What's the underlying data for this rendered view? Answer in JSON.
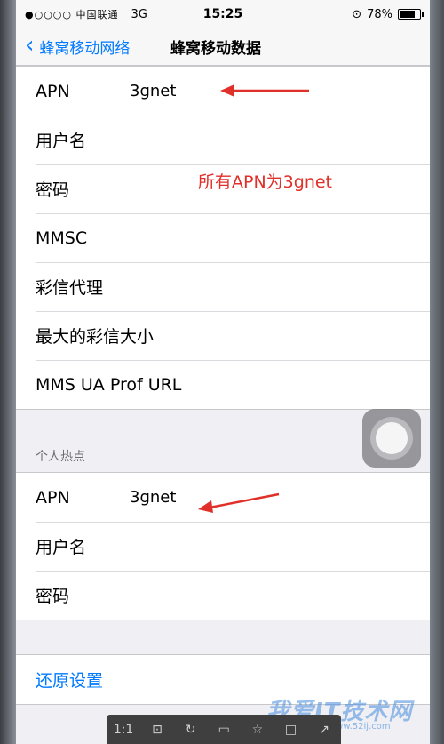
{
  "status_bar": {
    "carrier": "●○○○○ 中国联通",
    "network": "3G",
    "time": "15:25",
    "battery_pct_label": "78%",
    "battery_level": 0.78
  },
  "nav": {
    "back_label": "蜂窝移动网络",
    "title": "蜂窝移动数据"
  },
  "cellular_data": {
    "rows": [
      {
        "label": "APN",
        "value": "3gnet"
      },
      {
        "label": "用户名",
        "value": ""
      },
      {
        "label": "密码",
        "value": ""
      },
      {
        "label": "MMSC",
        "value": ""
      },
      {
        "label": "彩信代理",
        "value": ""
      },
      {
        "label": "最大的彩信大小",
        "value": ""
      },
      {
        "label": "MMS UA Prof URL",
        "value": ""
      }
    ]
  },
  "hotspot": {
    "header": "个人热点",
    "rows": [
      {
        "label": "APN",
        "value": "3gnet"
      },
      {
        "label": "用户名",
        "value": ""
      },
      {
        "label": "密码",
        "value": ""
      }
    ]
  },
  "reset_label": "还原设置",
  "annotation": "所有APN为3gnet",
  "toolbar": {
    "zoom": "1:1"
  },
  "watermark": {
    "main": "我爱IT技术网",
    "sub": "www.52ij.com"
  },
  "colors": {
    "accent": "#007aff",
    "annotation": "#e0302a",
    "background": "#efeff4"
  }
}
